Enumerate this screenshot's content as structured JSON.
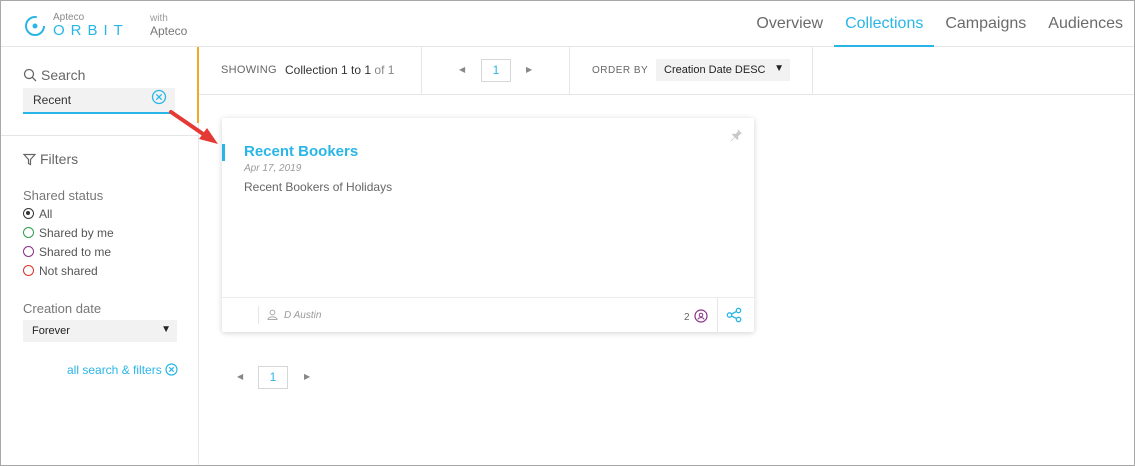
{
  "header": {
    "logo_small": "Apteco",
    "logo_big": "ORBIT",
    "with_line1": "with",
    "with_line2": "Apteco",
    "nav": [
      {
        "label": "Overview",
        "active": false
      },
      {
        "label": "Collections",
        "active": true
      },
      {
        "label": "Campaigns",
        "active": false
      },
      {
        "label": "Audiences",
        "active": false
      }
    ]
  },
  "sidebar": {
    "search_label": "Search",
    "search_value": "Recent",
    "filters_label": "Filters",
    "shared_status_title": "Shared status",
    "shared_options": [
      {
        "label": "All",
        "color": "#333333",
        "checked": true
      },
      {
        "label": "Shared by me",
        "color": "#2e9e4f",
        "checked": false
      },
      {
        "label": "Shared to me",
        "color": "#8a2e8a",
        "checked": false
      },
      {
        "label": "Not shared",
        "color": "#d9342b",
        "checked": false
      }
    ],
    "creation_date_title": "Creation date",
    "creation_date_value": "Forever",
    "clear_all_label": "all search & filters"
  },
  "toolbar": {
    "showing_label": "SHOWING",
    "showing_text": "Collection 1 to 1",
    "showing_of": "of 1",
    "page": "1",
    "order_by_label": "ORDER BY",
    "order_by_value": "Creation Date DESC"
  },
  "card": {
    "title": "Recent Bookers",
    "date": "Apr 17, 2019",
    "description": "Recent Bookers of Holidays",
    "owner": "D Austin",
    "share_count": "2"
  },
  "bottom_pager": {
    "page": "1"
  },
  "colors": {
    "accent": "#29b6e6",
    "highlight": "#f5a623",
    "arrow": "#e53935"
  }
}
